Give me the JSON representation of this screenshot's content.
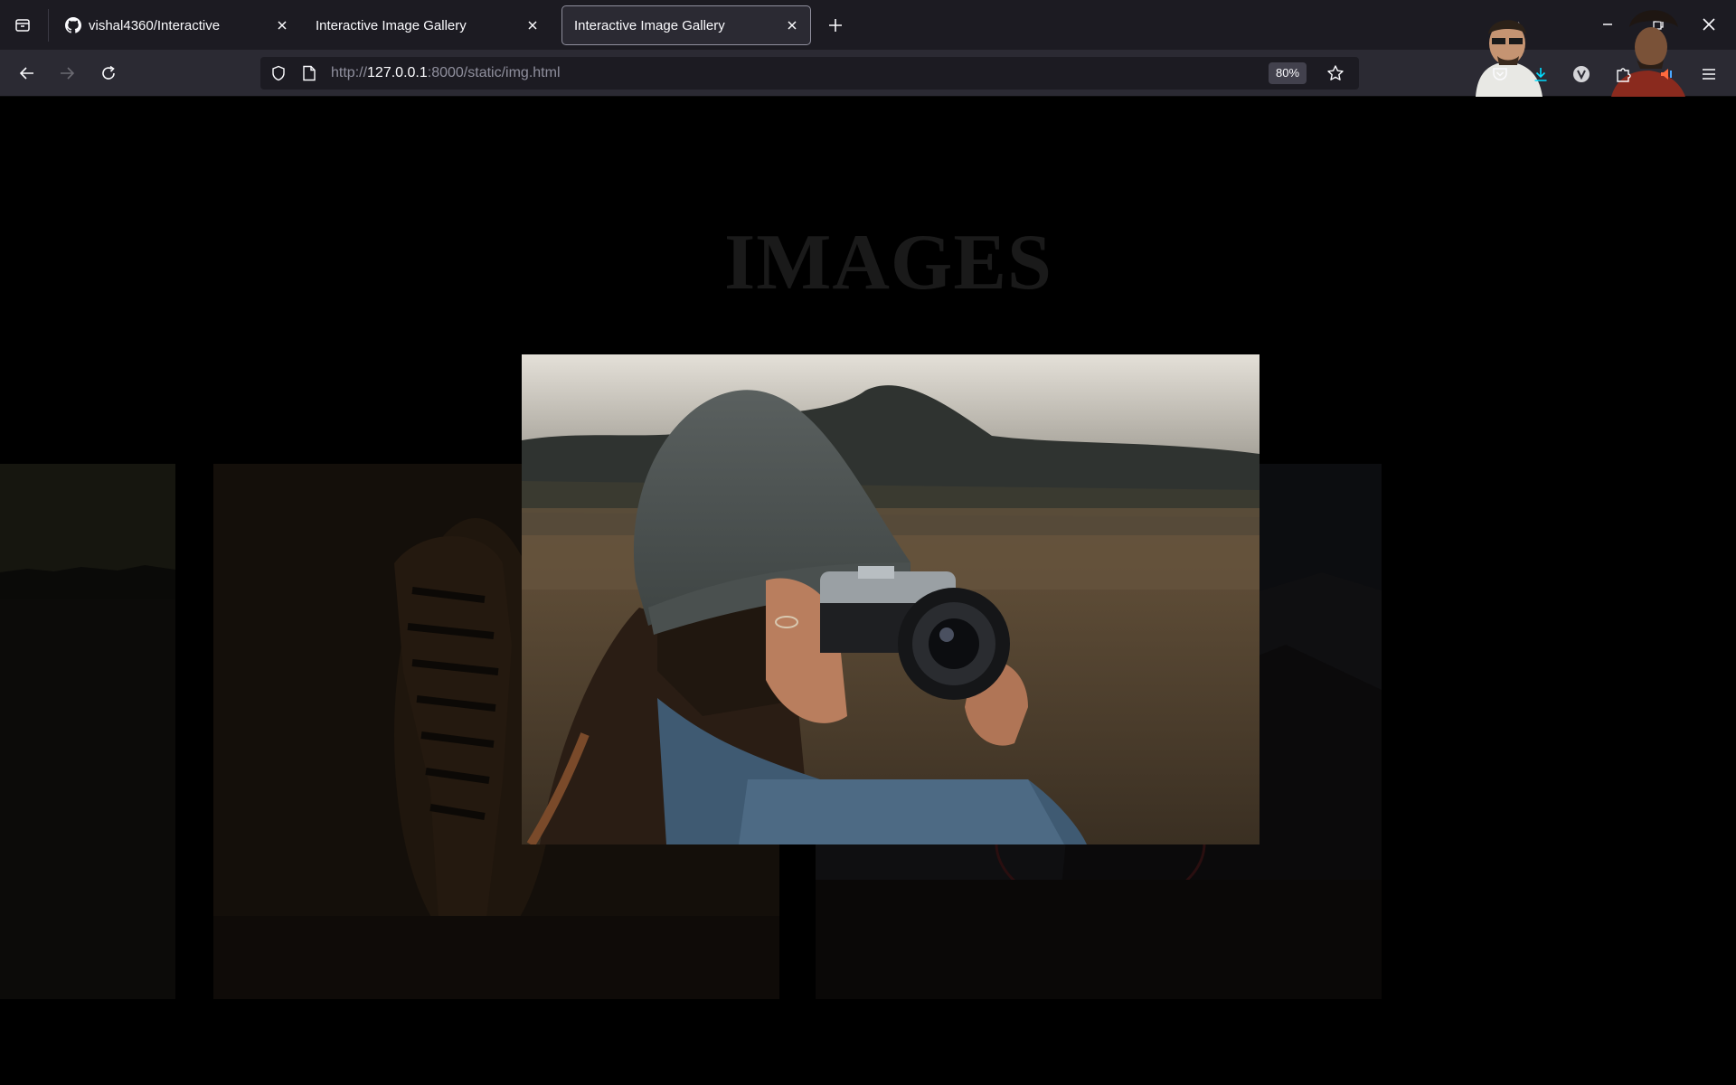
{
  "browser": {
    "tabs": [
      {
        "title": "vishal4360/Interactive",
        "favicon": "github-icon",
        "active": false
      },
      {
        "title": "Interactive Image Gallery",
        "favicon": "none",
        "active": false
      },
      {
        "title": "Interactive Image Gallery",
        "favicon": "none",
        "active": true
      }
    ],
    "url": {
      "scheme": "http://",
      "host": "127.0.0.1",
      "rest": ":8000/static/img.html"
    },
    "zoom": "80%"
  },
  "page": {
    "heading": "IMAGES",
    "images": [
      {
        "name": "left-card",
        "subject": "dark landscape"
      },
      {
        "name": "tiger-card",
        "subject": "tiger walking"
      },
      {
        "name": "right-card",
        "subject": "dark mountains with sun ring"
      },
      {
        "name": "featured-card",
        "subject": "person in beanie taking a photo with camera"
      }
    ]
  },
  "colors": {
    "tabstrip": "#1c1b22",
    "navbar": "#2b2a33",
    "page_background": "#000000",
    "heading": "#1a1a1a",
    "download_accent": "#00ddff"
  }
}
